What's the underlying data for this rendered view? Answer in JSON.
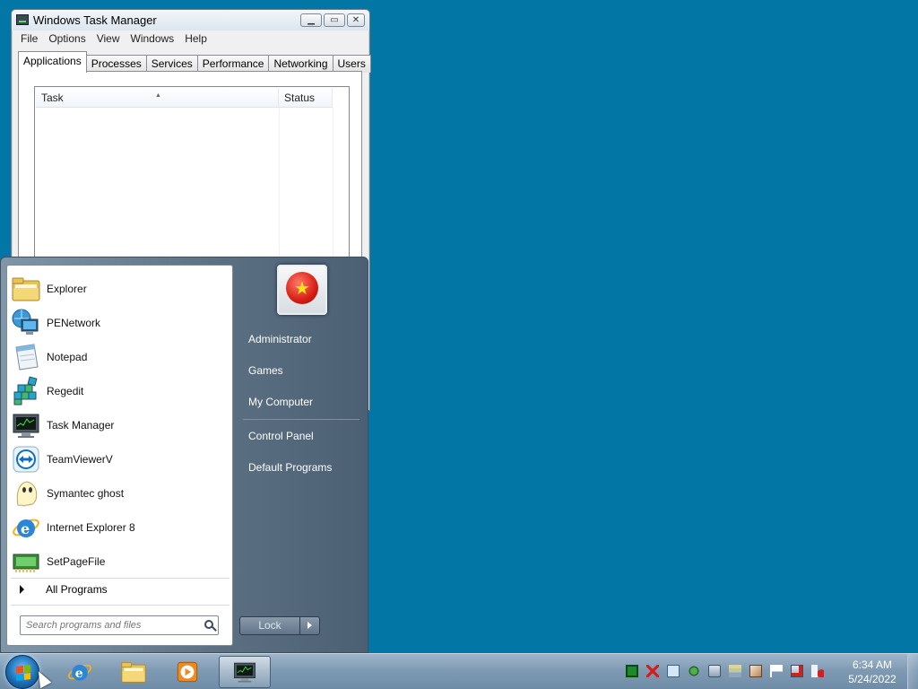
{
  "task_manager": {
    "title": "Windows Task Manager",
    "caption_buttons": [
      "minimize",
      "maximize",
      "close"
    ],
    "menu": [
      "File",
      "Options",
      "View",
      "Windows",
      "Help"
    ],
    "tabs": [
      "Applications",
      "Processes",
      "Services",
      "Performance",
      "Networking",
      "Users"
    ],
    "active_tab": "Applications",
    "columns": {
      "task": "Task",
      "status": "Status"
    },
    "rows": []
  },
  "start_menu": {
    "programs": [
      {
        "label": "Explorer",
        "icon": "folder-icon"
      },
      {
        "label": "PENetwork",
        "icon": "network-globe-icon"
      },
      {
        "label": "Notepad",
        "icon": "notepad-icon"
      },
      {
        "label": "Regedit",
        "icon": "registry-icon"
      },
      {
        "label": "Task Manager",
        "icon": "task-manager-icon"
      },
      {
        "label": "TeamViewerV",
        "icon": "teamviewer-icon"
      },
      {
        "label": "Symantec ghost",
        "icon": "ghost-icon"
      },
      {
        "label": "Internet Explorer 8",
        "icon": "internet-explorer-icon"
      },
      {
        "label": "SetPageFile",
        "icon": "pagefile-icon"
      }
    ],
    "all_programs": "All Programs",
    "search_placeholder": "Search programs and files",
    "right_items": {
      "administrator": "Administrator",
      "games": "Games",
      "my_computer": "My Computer",
      "control_panel": "Control Panel",
      "default_programs": "Default Programs"
    },
    "lock_label": "Lock"
  },
  "taskbar": {
    "pinned": [
      "internet-explorer-icon",
      "explorer-folder-icon",
      "media-player-icon",
      "task-manager-icon"
    ],
    "tray_icons": [
      "green-square-icon",
      "red-x-icon",
      "tray-app-icon",
      "tray-network-icon",
      "tray-usb-icon",
      "tray-layers-icon",
      "tray-eject-icon",
      "action-center-flag-icon",
      "network-disconnected-icon",
      "volume-muted-icon"
    ],
    "time": "6:34 AM",
    "date": "5/24/2022"
  }
}
